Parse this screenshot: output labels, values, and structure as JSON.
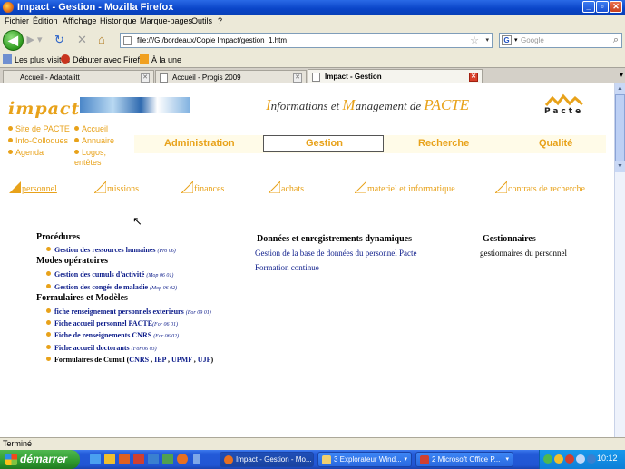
{
  "window": {
    "title": "Impact - Gestion - Mozilla Firefox"
  },
  "menu": [
    "Fichier",
    "Édition",
    "Affichage",
    "Historique",
    "Marque-pages",
    "Outils",
    "?"
  ],
  "navbar": {
    "url": "file:///G:/bordeaux/Copie Impact/gestion_1.htm",
    "search_placeholder": "Google",
    "search_engine_letter": "G"
  },
  "bookmarks": [
    "Les plus visités",
    "Débuter avec Firefox",
    "À la une"
  ],
  "tabs": [
    {
      "label": "Accueil - Adaptalitt",
      "active": false
    },
    {
      "label": "Accueil - Progis 2009",
      "active": false
    },
    {
      "label": "Impact - Gestion",
      "active": true
    }
  ],
  "site": {
    "logo": "impact",
    "tagline": {
      "I": "I",
      "part1": "nformations et ",
      "M": "M",
      "part2": "anagement de ",
      "P": "PACTE"
    },
    "pacte_word": "Pacte",
    "side_links_left": [
      "Site de PACTE",
      "Info-Colloques",
      "Agenda"
    ],
    "side_links_right": [
      "Accueil",
      "Annuaire",
      "Logos,",
      "entêtes"
    ],
    "main_nav": [
      "Administration",
      "Gestion",
      "Recherche",
      "Qualité"
    ],
    "sub_nav": [
      "personnel",
      "missions",
      "finances",
      "achats",
      "materiel et informatique",
      "contrats de recherche"
    ]
  },
  "columns": {
    "left": {
      "procedures_heading": "Procédures",
      "procedures": [
        {
          "label": "Gestion des ressources humaines",
          "ref": "(Pro 06)"
        }
      ],
      "modes_heading": "Modes opératoires",
      "modes": [
        {
          "label": "Gestion des cumuls d'activité",
          "ref": "(Mop 06 01)"
        },
        {
          "label": "Gestion des congés de maladie",
          "ref": "(Mop 06 02)"
        }
      ],
      "forms_heading": "Formulaires et Modèles",
      "forms": [
        {
          "label": "fiche renseignement personnels exterieurs",
          "ref": "(For 09 01)"
        },
        {
          "label": "Fiche accueil personnel PACTE",
          "ref": "(For 06 01)"
        },
        {
          "label": "Fiche de renseignements CNRS",
          "ref": "(For 06 02)"
        },
        {
          "label": "Fiche accueil doctorants",
          "ref": "(For 06 03)"
        }
      ],
      "cumul": {
        "prefix": "Formulaires de Cumul (",
        "links": [
          "CNRS",
          "IEP",
          "UPMF",
          "UJF"
        ],
        "sep": " , ",
        "suffix": ")"
      }
    },
    "middle": {
      "heading": "Données et enregistrements dynamiques",
      "items": [
        "Gestion de la base de données du personnel Pacte",
        "Formation continue"
      ]
    },
    "right": {
      "heading": "Gestionnaires",
      "items": [
        "gestionnaires du personnel"
      ]
    }
  },
  "status": "Terminé",
  "taskbar": {
    "start": "démarrer",
    "tasks": [
      {
        "label": "Impact - Gestion - Mo...",
        "active": true
      },
      {
        "label": "3 Explorateur Wind...",
        "active": false
      },
      {
        "label": "2 Microsoft Office P...",
        "active": false
      }
    ],
    "clock": "10:12"
  },
  "colors": {
    "accent": "#e8a21a",
    "link": "#0c1c8a",
    "titlebar": "#0a45c8",
    "taskbar": "#2156d4"
  }
}
